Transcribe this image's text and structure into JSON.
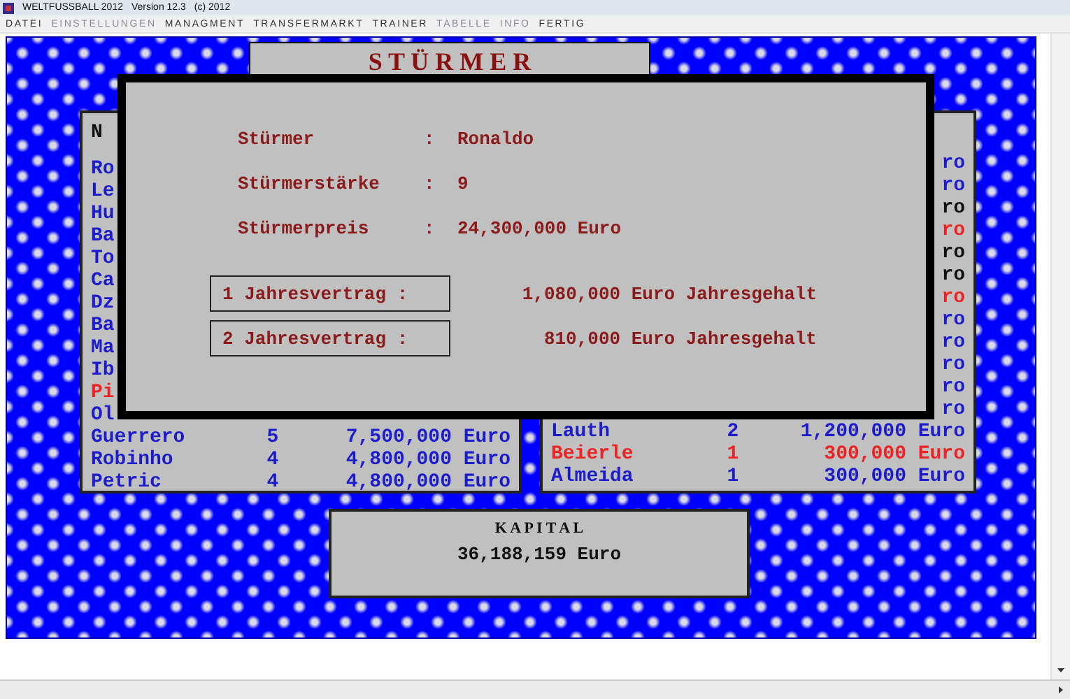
{
  "window": {
    "title": "WELTFUSSBALL 2012",
    "version": "Version 12.3",
    "copyright": "(c) 2012"
  },
  "menu": [
    {
      "label": "DATEI",
      "disabled": false
    },
    {
      "label": "EINSTELLUNGEN",
      "disabled": true
    },
    {
      "label": "MANAGMENT",
      "disabled": false
    },
    {
      "label": "TRANSFERMARKT",
      "disabled": false
    },
    {
      "label": "TRAINER",
      "disabled": false
    },
    {
      "label": "TABELLE",
      "disabled": true
    },
    {
      "label": "INFO",
      "disabled": true
    },
    {
      "label": "FERTIG",
      "disabled": false
    }
  ],
  "title_panel": {
    "title": "S T Ü R M E R"
  },
  "left_panel": {
    "header": "N",
    "rows": [
      {
        "name": "Ro",
        "color": "#1c1ccc"
      },
      {
        "name": "Le",
        "color": "#1c1ccc"
      },
      {
        "name": "Hu",
        "color": "#1c1ccc"
      },
      {
        "name": "Ba",
        "color": "#1c1ccc"
      },
      {
        "name": "To",
        "color": "#1c1ccc"
      },
      {
        "name": "Ca",
        "color": "#1c1ccc"
      },
      {
        "name": "Dz",
        "color": "#1c1ccc"
      },
      {
        "name": "Ba",
        "color": "#1c1ccc"
      },
      {
        "name": "Ma",
        "color": "#1c1ccc"
      },
      {
        "name": "Ib",
        "color": "#1c1ccc"
      },
      {
        "name": "Pi",
        "color": "#ee2222"
      },
      {
        "name": "Ol",
        "color": "#1c1ccc"
      },
      {
        "name": "Guerrero",
        "strength": "5",
        "price": "7,500,000 Euro",
        "color": "#1c1ccc"
      },
      {
        "name": "Robinho",
        "strength": "4",
        "price": "4,800,000 Euro",
        "color": "#1c1ccc"
      },
      {
        "name": "Petric",
        "strength": "4",
        "price": "4,800,000 Euro",
        "color": "#1c1ccc"
      }
    ]
  },
  "right_panel": {
    "rows": [
      {
        "price": "ro",
        "color": "#1c1ccc"
      },
      {
        "price": "ro",
        "color": "#1c1ccc"
      },
      {
        "price": "ro",
        "color": "#111111"
      },
      {
        "price": "ro",
        "color": "#ee2222"
      },
      {
        "price": "ro",
        "color": "#111111"
      },
      {
        "price": "ro",
        "color": "#111111"
      },
      {
        "price": "ro",
        "color": "#ee2222"
      },
      {
        "price": "ro",
        "color": "#1c1ccc"
      },
      {
        "price": "ro",
        "color": "#1c1ccc"
      },
      {
        "price": "ro",
        "color": "#1c1ccc"
      },
      {
        "price": "ro",
        "color": "#1c1ccc"
      },
      {
        "price": "ro",
        "color": "#1c1ccc"
      },
      {
        "name": "Lauth",
        "strength": "2",
        "price": "1,200,000 Euro",
        "color": "#1c1ccc"
      },
      {
        "name": "Beierle",
        "strength": "1",
        "price": "300,000 Euro",
        "color": "#ee2222"
      },
      {
        "name": "Almeida",
        "strength": "1",
        "price": "300,000 Euro",
        "color": "#1c1ccc"
      }
    ]
  },
  "dialog": {
    "info": [
      {
        "label": "Stürmer",
        "separator": ":",
        "value": "Ronaldo"
      },
      {
        "label": "Stürmerstärke",
        "separator": ":",
        "value": "9"
      },
      {
        "label": "Stürmerpreis",
        "separator": ":",
        "value": "24,300,000 Euro"
      }
    ],
    "contracts": [
      {
        "button": "1 Jahresvertrag :",
        "salary": "1,080,000 Euro Jahresgehalt"
      },
      {
        "button": "2 Jahresvertrag :",
        "salary": "810,000 Euro Jahresgehalt"
      }
    ]
  },
  "capital": {
    "title": "K A P I T A L",
    "amount": "36,188,159 Euro"
  }
}
